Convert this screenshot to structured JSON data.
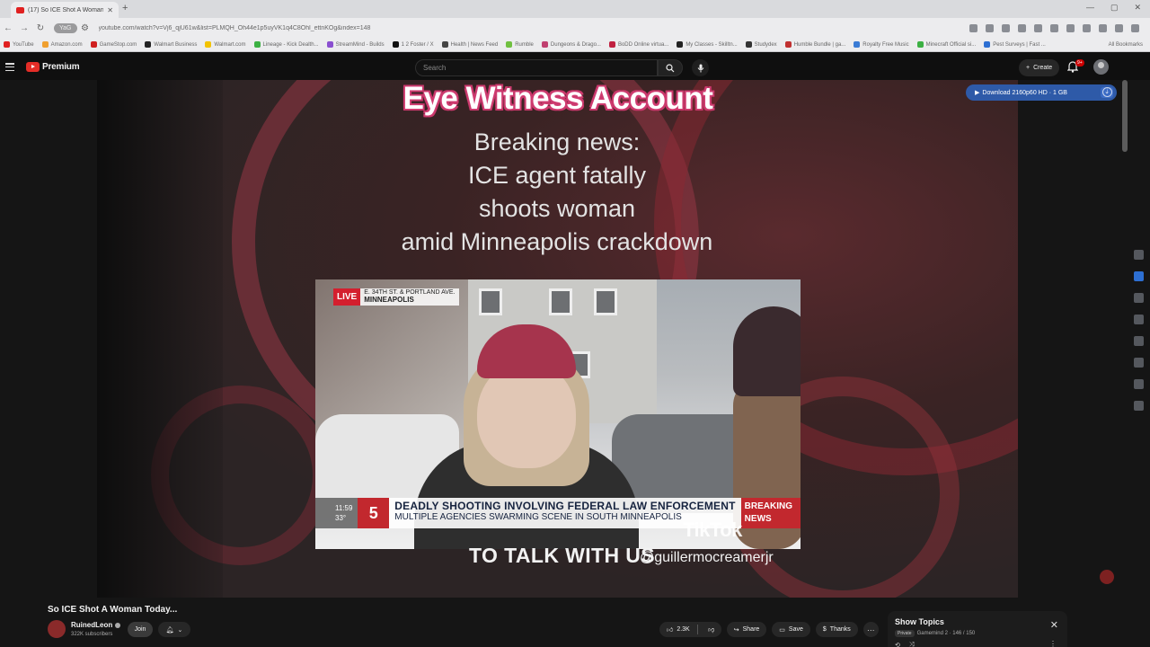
{
  "browser": {
    "tab_title": "(17) So ICE Shot A Woman Tod...",
    "new_tab": "+",
    "url": "youtube.com/watch?v=Vj6_qjU61w&list=PLMQH_Oh44e1p5uyVK1q4C8Ohl_ettnKOg&index=148",
    "chip": "YaG",
    "bookmarks": [
      {
        "label": "YouTube",
        "color": "#e02020"
      },
      {
        "label": "Amazon.com",
        "color": "#f0a030"
      },
      {
        "label": "GameStop.com",
        "color": "#d02020"
      },
      {
        "label": "Walmart Business",
        "color": "#222222"
      },
      {
        "label": "Walmart.com",
        "color": "#f3c300"
      },
      {
        "label": "Lineage - Kick Dealth...",
        "color": "#3cb043"
      },
      {
        "label": "StreamMind - Builds",
        "color": "#8a4fd0"
      },
      {
        "label": "1 2 Foster / X",
        "color": "#111111"
      },
      {
        "label": "Health | News Feed",
        "color": "#444444"
      },
      {
        "label": "Rumble",
        "color": "#70c040"
      },
      {
        "label": "Dungeons & Drago...",
        "color": "#c04070"
      },
      {
        "label": "BoDD Online virtua...",
        "color": "#c02040"
      },
      {
        "label": "My Classes - Skilltn...",
        "color": "#222222"
      },
      {
        "label": "Studydex",
        "color": "#333333"
      },
      {
        "label": "Humble Bundle | ga...",
        "color": "#c03030"
      },
      {
        "label": "Royalty Free Music",
        "color": "#3a7bd5"
      },
      {
        "label": "Minecraft Official si...",
        "color": "#3cb043"
      },
      {
        "label": "Pest Surveys | Fast ...",
        "color": "#2d6fd2"
      }
    ],
    "all_bookmarks": "All Bookmarks"
  },
  "masthead": {
    "logo_text": "Premium",
    "search_placeholder": "Search",
    "create_label": "Create",
    "notif_count": "9+"
  },
  "video": {
    "overlay_title": "Eye Witness Account",
    "headline": [
      "Breaking news:",
      "ICE agent fatally",
      "shoots woman",
      "amid Minneapolis crackdown"
    ],
    "live_label": "LIVE",
    "location_street": "E. 34TH ST. & PORTLAND AVE.",
    "location_city": "MINNEAPOLIS",
    "ticker_time": "11:59",
    "ticker_temp": "33°",
    "ticker_logo": "5",
    "ticker_line1": "DEADLY SHOOTING INVOLVING FEDERAL LAW ENFORCEMENT",
    "ticker_line2": "MULTIPLE AGENCIES SWARMING SCENE IN SOUTH MINNEAPOLIS",
    "ticker_breaking": "BREAKING NEWS",
    "watermark": "TikTok",
    "caption": "TO TALK WITH US",
    "handle": "@guillermocreamerjr"
  },
  "download": {
    "label": "Download 2160p60 HD · 1 GB"
  },
  "watch": {
    "title": "So ICE Shot A Woman Today...",
    "channel": "RuinedLeon",
    "subscribers": "322K subscribers",
    "join": "Join",
    "likes": "2.3K",
    "share": "Share",
    "save": "Save",
    "thanks": "Thanks"
  },
  "topics_panel": {
    "title": "Show Topics",
    "badge": "Private",
    "subtitle": "Gamemind 2 · 146 / 150"
  }
}
